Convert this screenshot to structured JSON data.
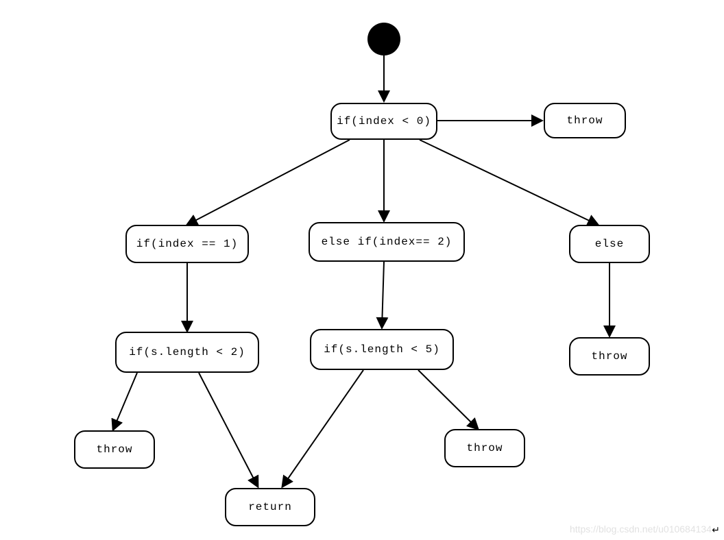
{
  "diagram": {
    "start": {
      "type": "initial"
    },
    "n1": {
      "label": "if(index < 0)"
    },
    "n2": {
      "label": "throw"
    },
    "n3": {
      "label": "if(index == 1)"
    },
    "n4": {
      "label": "else if(index== 2)"
    },
    "n5": {
      "label": "else"
    },
    "n6": {
      "label": "if(s.length < 2)"
    },
    "n7": {
      "label": "if(s.length < 5)"
    },
    "n8": {
      "label": "throw"
    },
    "n9": {
      "label": "throw"
    },
    "n10": {
      "label": "throw"
    },
    "n11": {
      "label": "return"
    }
  },
  "watermark": "https://blog.csdn.net/u010684134",
  "cr_symbol": "↵"
}
